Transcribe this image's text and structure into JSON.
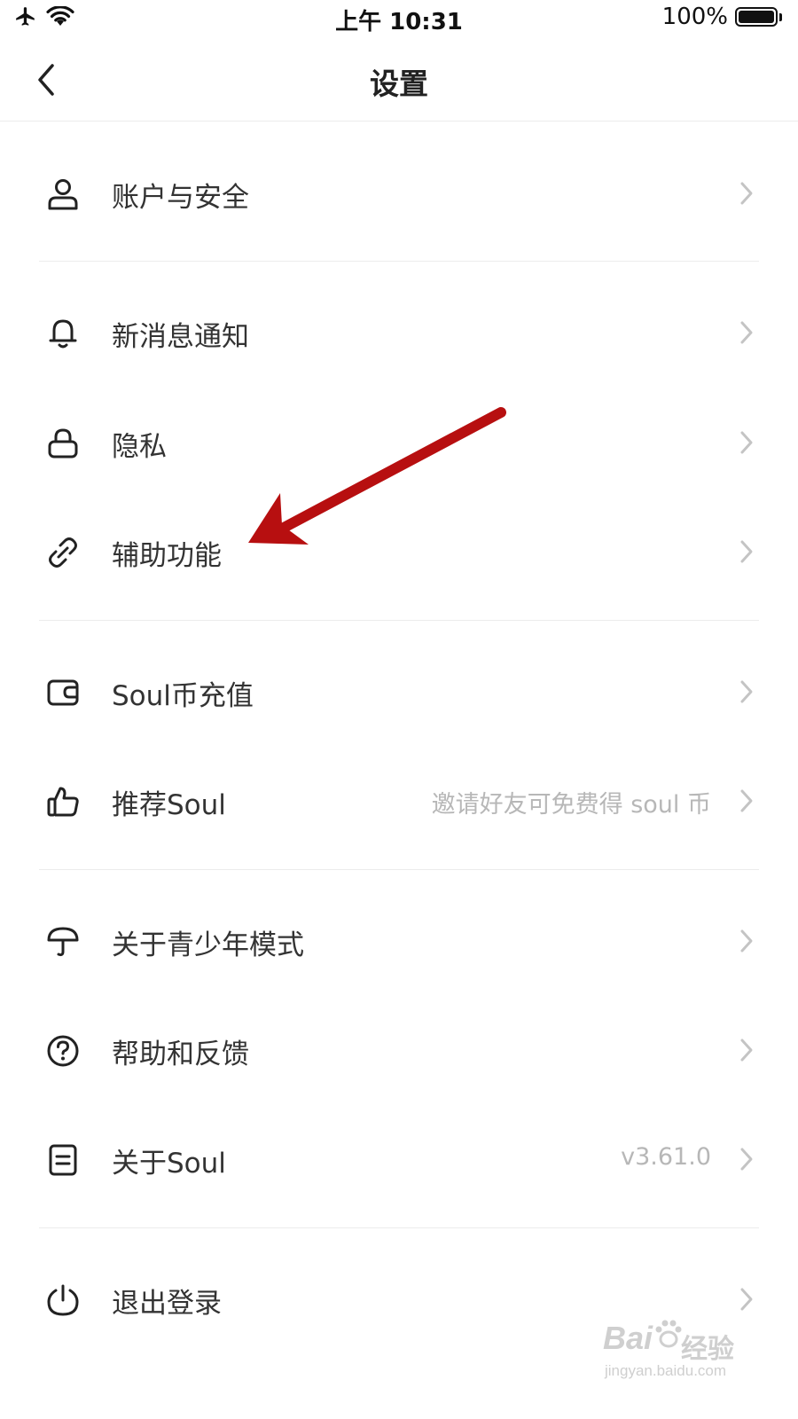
{
  "status_bar": {
    "time": "上午 10:31",
    "battery_text": "100%",
    "battery_level": 1.0,
    "icons": [
      "airplane-icon",
      "wifi-icon",
      "battery-icon"
    ]
  },
  "nav": {
    "title": "设置",
    "back_icon": "chevron-left-icon"
  },
  "menu": {
    "account_security": {
      "label": "账户与安全",
      "icon": "user-icon"
    },
    "notifications": {
      "label": "新消息通知",
      "icon": "bell-icon"
    },
    "privacy": {
      "label": "隐私",
      "icon": "lock-icon"
    },
    "accessibility": {
      "label": "辅助功能",
      "icon": "link-icon"
    },
    "recharge": {
      "label": "Soul币充值",
      "icon": "wallet-icon"
    },
    "recommend": {
      "label": "推荐Soul",
      "detail": "邀请好友可免费得 soul 币",
      "icon": "thumbs-up-icon"
    },
    "teen_mode": {
      "label": "关于青少年模式",
      "icon": "umbrella-icon"
    },
    "help": {
      "label": "帮助和反馈",
      "icon": "question-icon"
    },
    "about": {
      "label": "关于Soul",
      "detail": "v3.61.0",
      "icon": "document-icon"
    },
    "logout": {
      "label": "退出登录",
      "icon": "power-icon"
    }
  },
  "annotation": {
    "color": "#b70f10",
    "points_to": "accessibility"
  },
  "watermark": {
    "brand": "Bai",
    "brand_suffix": "经验",
    "url": "jingyan.baidu.com"
  },
  "colors": {
    "text": "#333333",
    "muted": "#b7b7b7",
    "divider": "#ececec",
    "chevron": "#c4c4c4"
  }
}
